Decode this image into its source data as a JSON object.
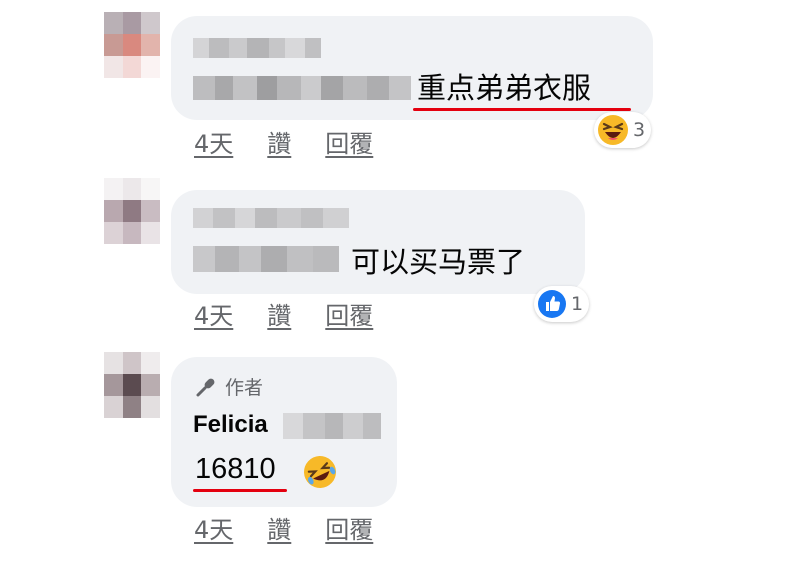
{
  "comments": [
    {
      "author_name": "",
      "text": "重点弟弟衣服",
      "actions": {
        "time": "4天",
        "like": "讚",
        "reply": "回覆"
      },
      "reaction": {
        "icon": "laughing-emoji",
        "count": "3"
      }
    },
    {
      "author_name": "",
      "text": "可以买马票了",
      "actions": {
        "time": "4天",
        "like": "讚",
        "reply": "回覆"
      },
      "reaction": {
        "icon": "like-thumb",
        "count": "1"
      }
    },
    {
      "author_badge": "作者",
      "author_name": "Felicia",
      "text": "16810",
      "emoji": "rolling-on-floor-laughing-emoji",
      "actions": {
        "time": "4天",
        "like": "讚",
        "reply": "回覆"
      }
    }
  ],
  "colors": {
    "bubble": "#f0f2f5",
    "underline_red": "#e4000f",
    "secondary_text": "#65676b",
    "like_blue": "#1877f2"
  }
}
